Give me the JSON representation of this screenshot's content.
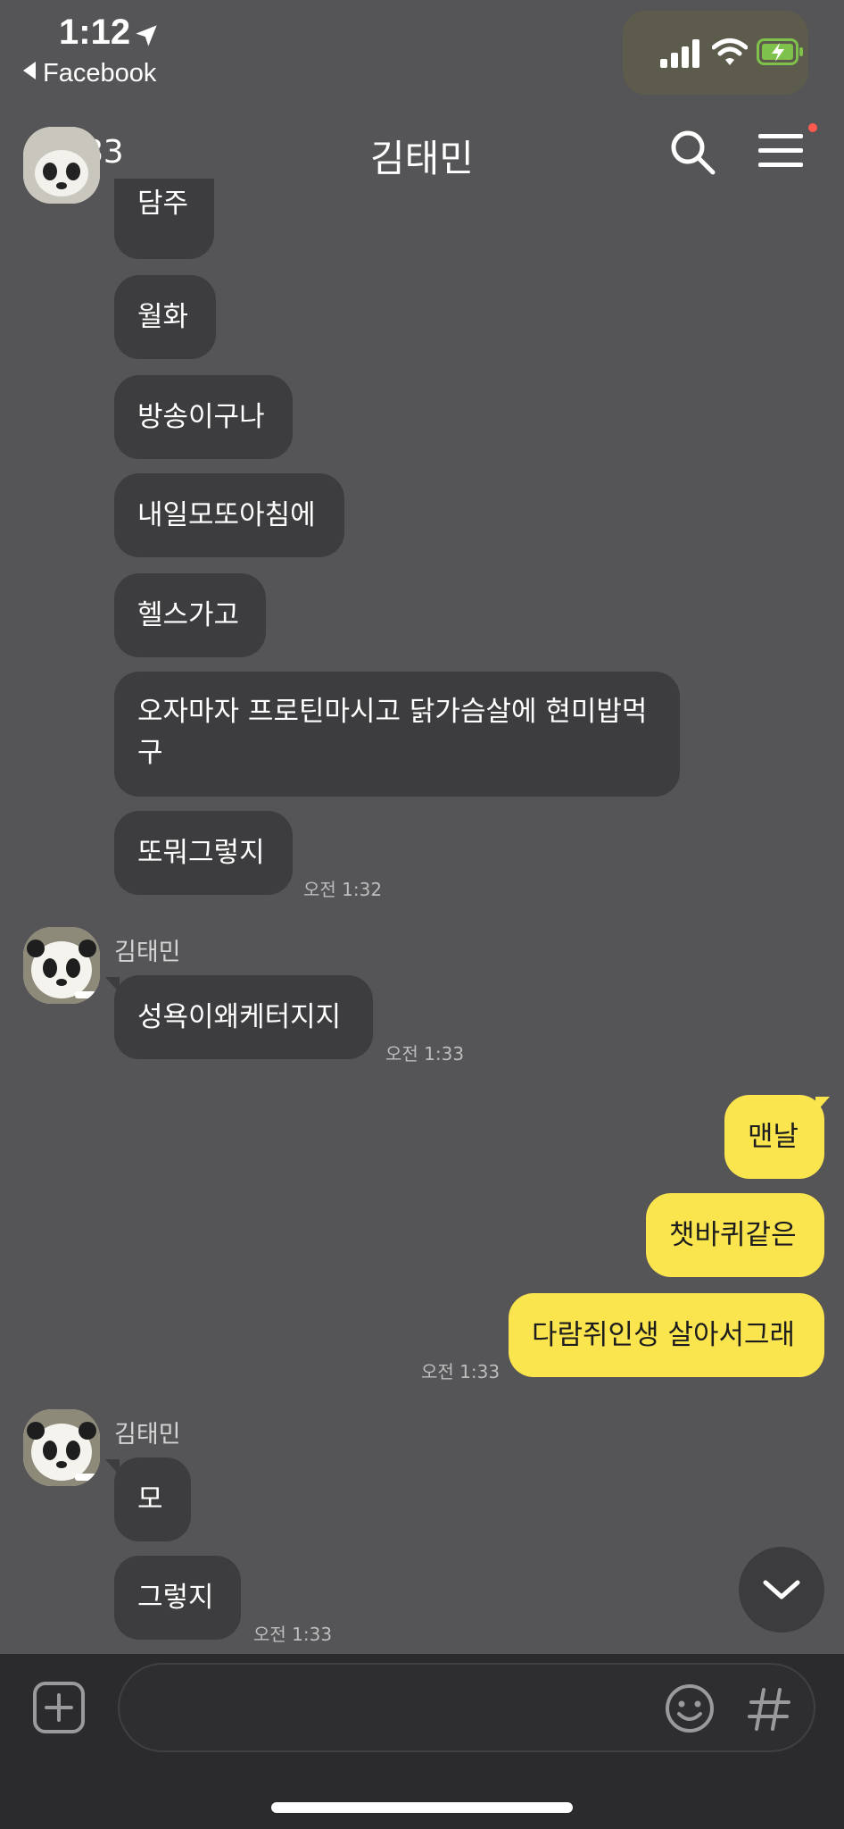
{
  "status_bar": {
    "time": "1:12",
    "back_app": "Facebook"
  },
  "header": {
    "back_count": "283",
    "title": "김태민"
  },
  "messages": {
    "m1": "담주",
    "m2": "월화",
    "m3": "방송이구나",
    "m4": "내일모또아침에",
    "m5": "헬스가고",
    "m6_line1": "오자마자 프로틴마시고 닭가슴살에 현미밥먹",
    "m6_line2": "구",
    "m7": "또뭐그렇지",
    "t1": "오전 1:32",
    "sender1": "김태민",
    "m8": "성욕이왜케터지지",
    "t2": "오전 1:33",
    "y1": "맨날",
    "y2": "챗바퀴같은",
    "y3": "다람쥐인생 살아서그래",
    "t3": "오전 1:33",
    "sender2": "김태민",
    "m9": "모",
    "m10": "그렇지",
    "t4": "오전 1:33"
  },
  "composer": {
    "placeholder": ""
  },
  "colors": {
    "background": "#555456",
    "incoming_bubble": "#3d3d3f",
    "outgoing_bubble": "#fae54f",
    "composer": "#2b2b2d",
    "notification_dot": "#ff5a4d"
  },
  "icons": [
    "location-arrow-icon",
    "signal-icon",
    "wifi-icon",
    "battery-charging-icon",
    "chevron-left-icon",
    "search-icon",
    "menu-icon",
    "panda-avatar",
    "chevron-down-icon",
    "plus-icon",
    "emoji-icon",
    "hash-icon"
  ]
}
